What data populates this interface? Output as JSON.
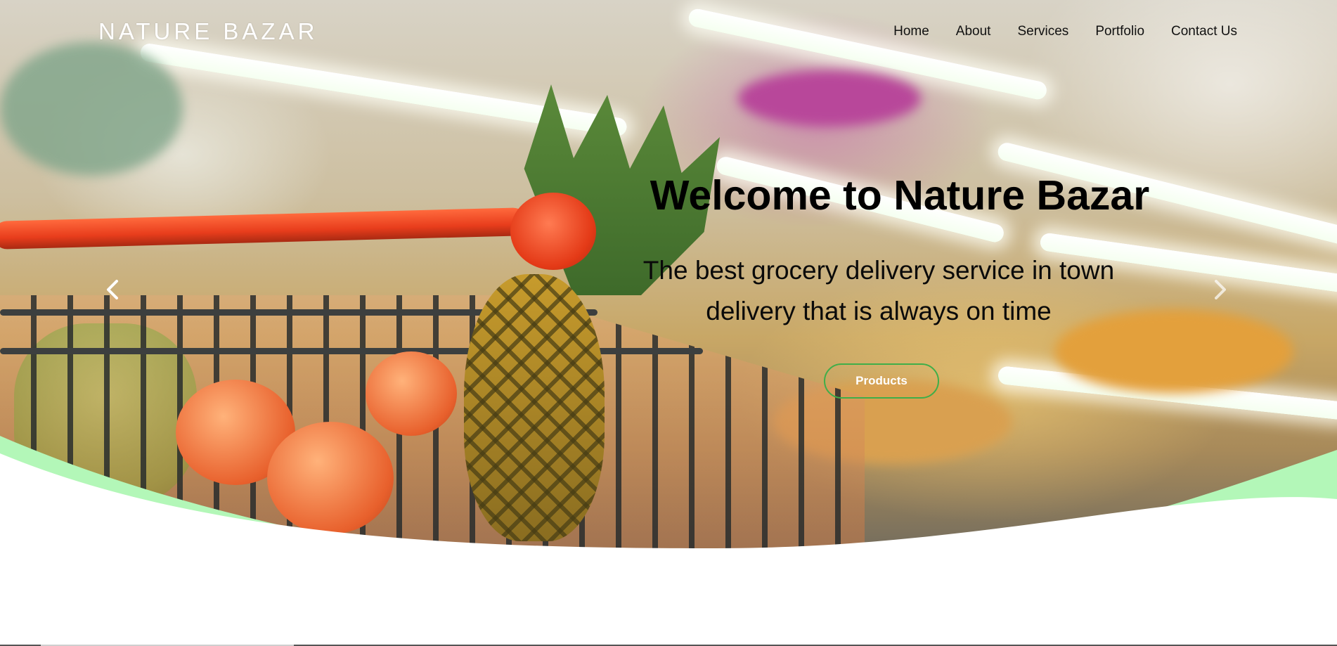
{
  "brand": {
    "name": "NATURE BAZAR"
  },
  "nav": {
    "items": [
      {
        "label": "Home"
      },
      {
        "label": "About"
      },
      {
        "label": "Services"
      },
      {
        "label": "Portfolio"
      },
      {
        "label": "Contact Us"
      }
    ]
  },
  "hero": {
    "title": "Welcome to Nature Bazar",
    "subtitle_line1": "The best grocery delivery service in town",
    "subtitle_line2": "delivery that is always on time",
    "cta_label": "Products",
    "prev_icon": "chevron-left-icon",
    "next_icon": "chevron-right-icon"
  },
  "colors": {
    "accent_green": "#3fae49",
    "curve_green": "#b3f7b8",
    "background": "#ffffff"
  }
}
